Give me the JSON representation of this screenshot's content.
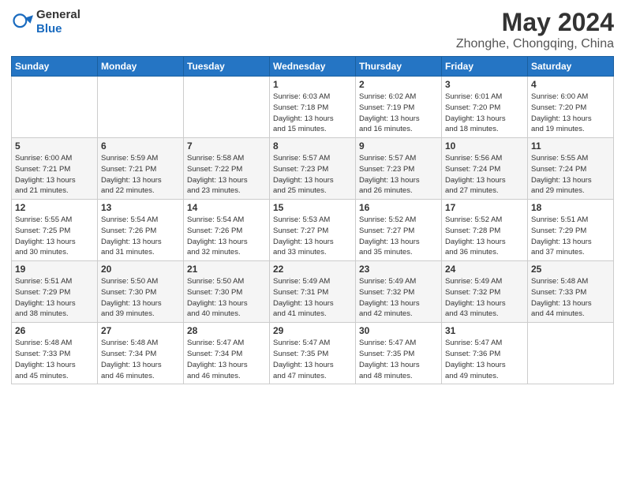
{
  "header": {
    "logo_general": "General",
    "logo_blue": "Blue",
    "title": "May 2024",
    "subtitle": "Zhonghe, Chongqing, China"
  },
  "calendar": {
    "days_of_week": [
      "Sunday",
      "Monday",
      "Tuesday",
      "Wednesday",
      "Thursday",
      "Friday",
      "Saturday"
    ],
    "weeks": [
      [
        {
          "day": "",
          "info": ""
        },
        {
          "day": "",
          "info": ""
        },
        {
          "day": "",
          "info": ""
        },
        {
          "day": "1",
          "info": "Sunrise: 6:03 AM\nSunset: 7:18 PM\nDaylight: 13 hours\nand 15 minutes."
        },
        {
          "day": "2",
          "info": "Sunrise: 6:02 AM\nSunset: 7:19 PM\nDaylight: 13 hours\nand 16 minutes."
        },
        {
          "day": "3",
          "info": "Sunrise: 6:01 AM\nSunset: 7:20 PM\nDaylight: 13 hours\nand 18 minutes."
        },
        {
          "day": "4",
          "info": "Sunrise: 6:00 AM\nSunset: 7:20 PM\nDaylight: 13 hours\nand 19 minutes."
        }
      ],
      [
        {
          "day": "5",
          "info": "Sunrise: 6:00 AM\nSunset: 7:21 PM\nDaylight: 13 hours\nand 21 minutes."
        },
        {
          "day": "6",
          "info": "Sunrise: 5:59 AM\nSunset: 7:21 PM\nDaylight: 13 hours\nand 22 minutes."
        },
        {
          "day": "7",
          "info": "Sunrise: 5:58 AM\nSunset: 7:22 PM\nDaylight: 13 hours\nand 23 minutes."
        },
        {
          "day": "8",
          "info": "Sunrise: 5:57 AM\nSunset: 7:23 PM\nDaylight: 13 hours\nand 25 minutes."
        },
        {
          "day": "9",
          "info": "Sunrise: 5:57 AM\nSunset: 7:23 PM\nDaylight: 13 hours\nand 26 minutes."
        },
        {
          "day": "10",
          "info": "Sunrise: 5:56 AM\nSunset: 7:24 PM\nDaylight: 13 hours\nand 27 minutes."
        },
        {
          "day": "11",
          "info": "Sunrise: 5:55 AM\nSunset: 7:24 PM\nDaylight: 13 hours\nand 29 minutes."
        }
      ],
      [
        {
          "day": "12",
          "info": "Sunrise: 5:55 AM\nSunset: 7:25 PM\nDaylight: 13 hours\nand 30 minutes."
        },
        {
          "day": "13",
          "info": "Sunrise: 5:54 AM\nSunset: 7:26 PM\nDaylight: 13 hours\nand 31 minutes."
        },
        {
          "day": "14",
          "info": "Sunrise: 5:54 AM\nSunset: 7:26 PM\nDaylight: 13 hours\nand 32 minutes."
        },
        {
          "day": "15",
          "info": "Sunrise: 5:53 AM\nSunset: 7:27 PM\nDaylight: 13 hours\nand 33 minutes."
        },
        {
          "day": "16",
          "info": "Sunrise: 5:52 AM\nSunset: 7:27 PM\nDaylight: 13 hours\nand 35 minutes."
        },
        {
          "day": "17",
          "info": "Sunrise: 5:52 AM\nSunset: 7:28 PM\nDaylight: 13 hours\nand 36 minutes."
        },
        {
          "day": "18",
          "info": "Sunrise: 5:51 AM\nSunset: 7:29 PM\nDaylight: 13 hours\nand 37 minutes."
        }
      ],
      [
        {
          "day": "19",
          "info": "Sunrise: 5:51 AM\nSunset: 7:29 PM\nDaylight: 13 hours\nand 38 minutes."
        },
        {
          "day": "20",
          "info": "Sunrise: 5:50 AM\nSunset: 7:30 PM\nDaylight: 13 hours\nand 39 minutes."
        },
        {
          "day": "21",
          "info": "Sunrise: 5:50 AM\nSunset: 7:30 PM\nDaylight: 13 hours\nand 40 minutes."
        },
        {
          "day": "22",
          "info": "Sunrise: 5:49 AM\nSunset: 7:31 PM\nDaylight: 13 hours\nand 41 minutes."
        },
        {
          "day": "23",
          "info": "Sunrise: 5:49 AM\nSunset: 7:32 PM\nDaylight: 13 hours\nand 42 minutes."
        },
        {
          "day": "24",
          "info": "Sunrise: 5:49 AM\nSunset: 7:32 PM\nDaylight: 13 hours\nand 43 minutes."
        },
        {
          "day": "25",
          "info": "Sunrise: 5:48 AM\nSunset: 7:33 PM\nDaylight: 13 hours\nand 44 minutes."
        }
      ],
      [
        {
          "day": "26",
          "info": "Sunrise: 5:48 AM\nSunset: 7:33 PM\nDaylight: 13 hours\nand 45 minutes."
        },
        {
          "day": "27",
          "info": "Sunrise: 5:48 AM\nSunset: 7:34 PM\nDaylight: 13 hours\nand 46 minutes."
        },
        {
          "day": "28",
          "info": "Sunrise: 5:47 AM\nSunset: 7:34 PM\nDaylight: 13 hours\nand 46 minutes."
        },
        {
          "day": "29",
          "info": "Sunrise: 5:47 AM\nSunset: 7:35 PM\nDaylight: 13 hours\nand 47 minutes."
        },
        {
          "day": "30",
          "info": "Sunrise: 5:47 AM\nSunset: 7:35 PM\nDaylight: 13 hours\nand 48 minutes."
        },
        {
          "day": "31",
          "info": "Sunrise: 5:47 AM\nSunset: 7:36 PM\nDaylight: 13 hours\nand 49 minutes."
        },
        {
          "day": "",
          "info": ""
        }
      ]
    ]
  }
}
